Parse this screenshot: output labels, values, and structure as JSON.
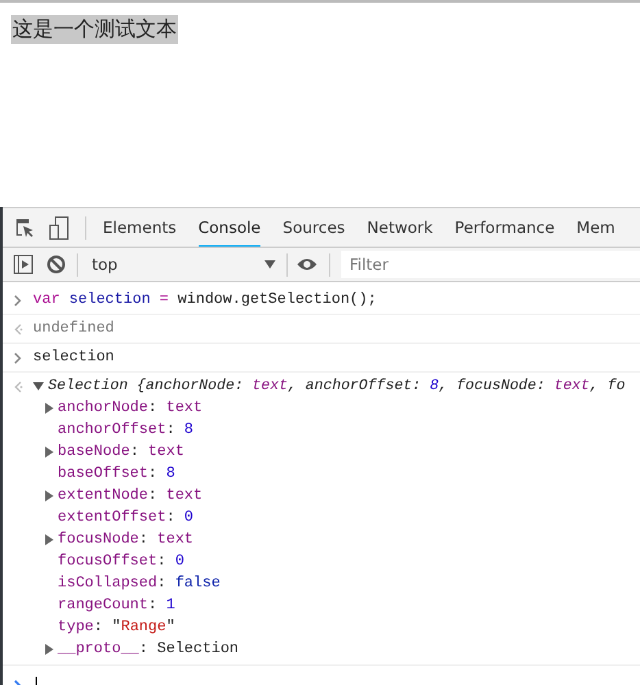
{
  "page": {
    "text": "这是一个测试文本",
    "selected": true
  },
  "devtools": {
    "tabs": [
      {
        "label": "Elements",
        "selected": false
      },
      {
        "label": "Console",
        "selected": true
      },
      {
        "label": "Sources",
        "selected": false
      },
      {
        "label": "Network",
        "selected": false
      },
      {
        "label": "Performance",
        "selected": false
      },
      {
        "label": "Mem",
        "selected": false
      }
    ],
    "console_toolbar": {
      "context": "top",
      "filter_placeholder": "Filter"
    },
    "console": [
      {
        "kind": "input",
        "tokens": [
          {
            "text": "var ",
            "kind": "keyword"
          },
          {
            "text": "selection",
            "kind": "variable"
          },
          {
            "text": " = ",
            "kind": "operator"
          },
          {
            "text": "window.getSelection();",
            "kind": "plain"
          }
        ]
      },
      {
        "kind": "result",
        "text": "undefined"
      },
      {
        "kind": "input",
        "tokens": [
          {
            "text": "selection",
            "kind": "plain"
          }
        ]
      },
      {
        "kind": "object",
        "expanded": true,
        "tokens": [
          {
            "text": "Selection {anchorNode: ",
            "kind": "plain"
          },
          {
            "text": "text",
            "kind": "node"
          },
          {
            "text": ", anchorOffset: ",
            "kind": "plain"
          },
          {
            "text": "8",
            "kind": "number"
          },
          {
            "text": ", focusNode: ",
            "kind": "plain"
          },
          {
            "text": "text",
            "kind": "node"
          },
          {
            "text": ", fo",
            "kind": "plain"
          }
        ],
        "properties": [
          {
            "expanded": false,
            "tokens": [
              {
                "text": "anchorNode",
                "kind": "key"
              },
              {
                "text": ": ",
                "kind": "plain"
              },
              {
                "text": "text",
                "kind": "node"
              }
            ]
          },
          {
            "tokens": [
              {
                "text": "anchorOffset",
                "kind": "key"
              },
              {
                "text": ": ",
                "kind": "plain"
              },
              {
                "text": "8",
                "kind": "number"
              }
            ]
          },
          {
            "expanded": false,
            "tokens": [
              {
                "text": "baseNode",
                "kind": "key"
              },
              {
                "text": ": ",
                "kind": "plain"
              },
              {
                "text": "text",
                "kind": "node"
              }
            ]
          },
          {
            "tokens": [
              {
                "text": "baseOffset",
                "kind": "key"
              },
              {
                "text": ": ",
                "kind": "plain"
              },
              {
                "text": "8",
                "kind": "number"
              }
            ]
          },
          {
            "expanded": false,
            "tokens": [
              {
                "text": "extentNode",
                "kind": "key"
              },
              {
                "text": ": ",
                "kind": "plain"
              },
              {
                "text": "text",
                "kind": "node"
              }
            ]
          },
          {
            "tokens": [
              {
                "text": "extentOffset",
                "kind": "key"
              },
              {
                "text": ": ",
                "kind": "plain"
              },
              {
                "text": "0",
                "kind": "number"
              }
            ]
          },
          {
            "expanded": false,
            "tokens": [
              {
                "text": "focusNode",
                "kind": "key"
              },
              {
                "text": ": ",
                "kind": "plain"
              },
              {
                "text": "text",
                "kind": "node"
              }
            ]
          },
          {
            "tokens": [
              {
                "text": "focusOffset",
                "kind": "key"
              },
              {
                "text": ": ",
                "kind": "plain"
              },
              {
                "text": "0",
                "kind": "number"
              }
            ]
          },
          {
            "tokens": [
              {
                "text": "isCollapsed",
                "kind": "key"
              },
              {
                "text": ": ",
                "kind": "plain"
              },
              {
                "text": "false",
                "kind": "boolean"
              }
            ]
          },
          {
            "tokens": [
              {
                "text": "rangeCount",
                "kind": "key"
              },
              {
                "text": ": ",
                "kind": "plain"
              },
              {
                "text": "1",
                "kind": "number"
              }
            ]
          },
          {
            "tokens": [
              {
                "text": "type",
                "kind": "key"
              },
              {
                "text": ": \"",
                "kind": "plain"
              },
              {
                "text": "Range",
                "kind": "string"
              },
              {
                "text": "\"",
                "kind": "plain"
              }
            ]
          },
          {
            "expanded": false,
            "tokens": [
              {
                "text": "__proto__",
                "kind": "key"
              },
              {
                "text": ": Selection",
                "kind": "plain"
              }
            ]
          }
        ]
      },
      {
        "kind": "prompt"
      }
    ]
  }
}
